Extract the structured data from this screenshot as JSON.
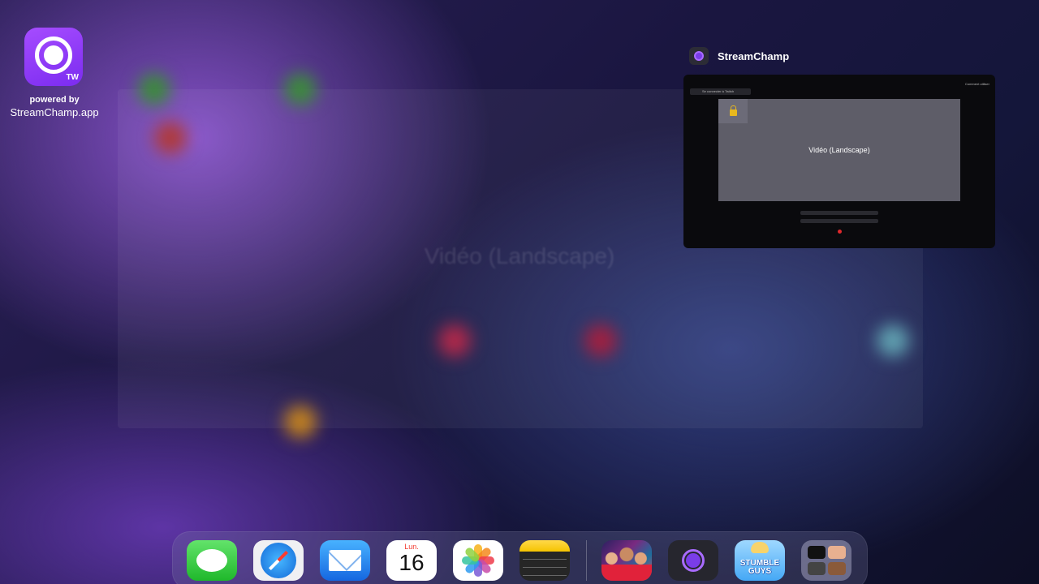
{
  "watermark": {
    "badge": "TW",
    "powered_by": "powered by",
    "url": "StreamChamp.app"
  },
  "background": {
    "blurred_title": "Vidéo (Landscape)"
  },
  "switcher": {
    "app_name": "StreamChamp",
    "preview": {
      "connect_label": "Se connecter à Twitch",
      "comment_label": "Comment utiliser",
      "video_label": "Vidéo (Landscape)"
    }
  },
  "dock": {
    "apps": [
      {
        "name": "Messages",
        "icon": "messages-icon"
      },
      {
        "name": "Safari",
        "icon": "safari-icon"
      },
      {
        "name": "Mail",
        "icon": "mail-icon"
      },
      {
        "name": "Calendar",
        "icon": "calendar-icon",
        "weekday": "Lun.",
        "day": "16"
      },
      {
        "name": "Photos",
        "icon": "photos-icon"
      },
      {
        "name": "Notes",
        "icon": "notes-icon"
      },
      {
        "name": "Game",
        "icon": "game-icon"
      },
      {
        "name": "StreamChamp",
        "icon": "streamchamp-icon"
      },
      {
        "name": "Stumble Guys",
        "icon": "stumble-guys-icon",
        "text": "STUMBLE GUYS"
      },
      {
        "name": "App Library",
        "icon": "app-library-icon"
      }
    ]
  },
  "colors": {
    "accent": "#7a3de8",
    "dock_bg": "#78789f"
  }
}
